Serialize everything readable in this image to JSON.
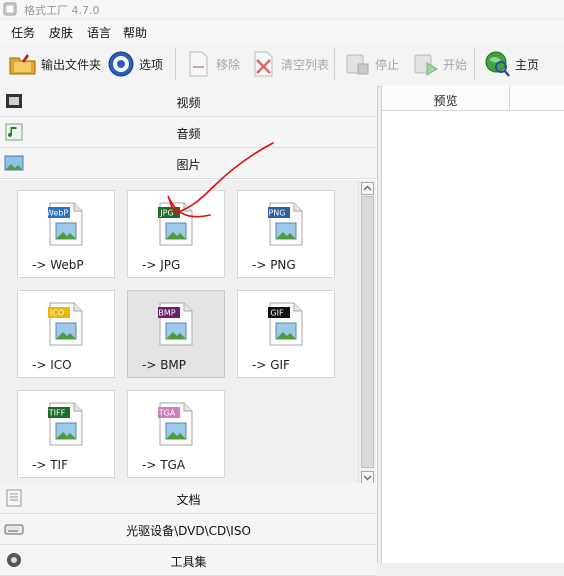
{
  "window": {
    "title": "格式工厂 4.7.0"
  },
  "menu": {
    "items": [
      "任务",
      "皮肤",
      "语言",
      "帮助"
    ]
  },
  "toolbar": {
    "output_folder": "输出文件夹",
    "options": "选项",
    "remove": "移除",
    "clear_list": "清空列表",
    "stop": "停止",
    "start": "开始",
    "home": "主页"
  },
  "categories": {
    "video": "视频",
    "audio": "音频",
    "image": "图片",
    "document": "文档",
    "optical": "光驱设备\\DVD\\CD\\ISO",
    "tools": "工具集"
  },
  "formats": [
    {
      "badge": "WebP",
      "label": "-> WebP",
      "color": "#2a73c8"
    },
    {
      "badge": "JPG",
      "label": "-> JPG",
      "color": "#1d6b2b"
    },
    {
      "badge": "PNG",
      "label": "-> PNG",
      "color": "#2d5f9c"
    },
    {
      "badge": "ICO",
      "label": "-> ICO",
      "color": "#e6b800"
    },
    {
      "badge": "BMP",
      "label": "-> BMP",
      "color": "#6a1f73"
    },
    {
      "badge": "GIF",
      "label": "-> GIF",
      "color": "#111111"
    },
    {
      "badge": "TIFF",
      "label": "-> TIF",
      "color": "#1d6b2b"
    },
    {
      "badge": "TGA",
      "label": "-> TGA",
      "color": "#cc7fb8"
    }
  ],
  "preview": {
    "header": "预览"
  },
  "colors": {
    "accent": "#2a73c8",
    "annotation": "#e01010"
  }
}
